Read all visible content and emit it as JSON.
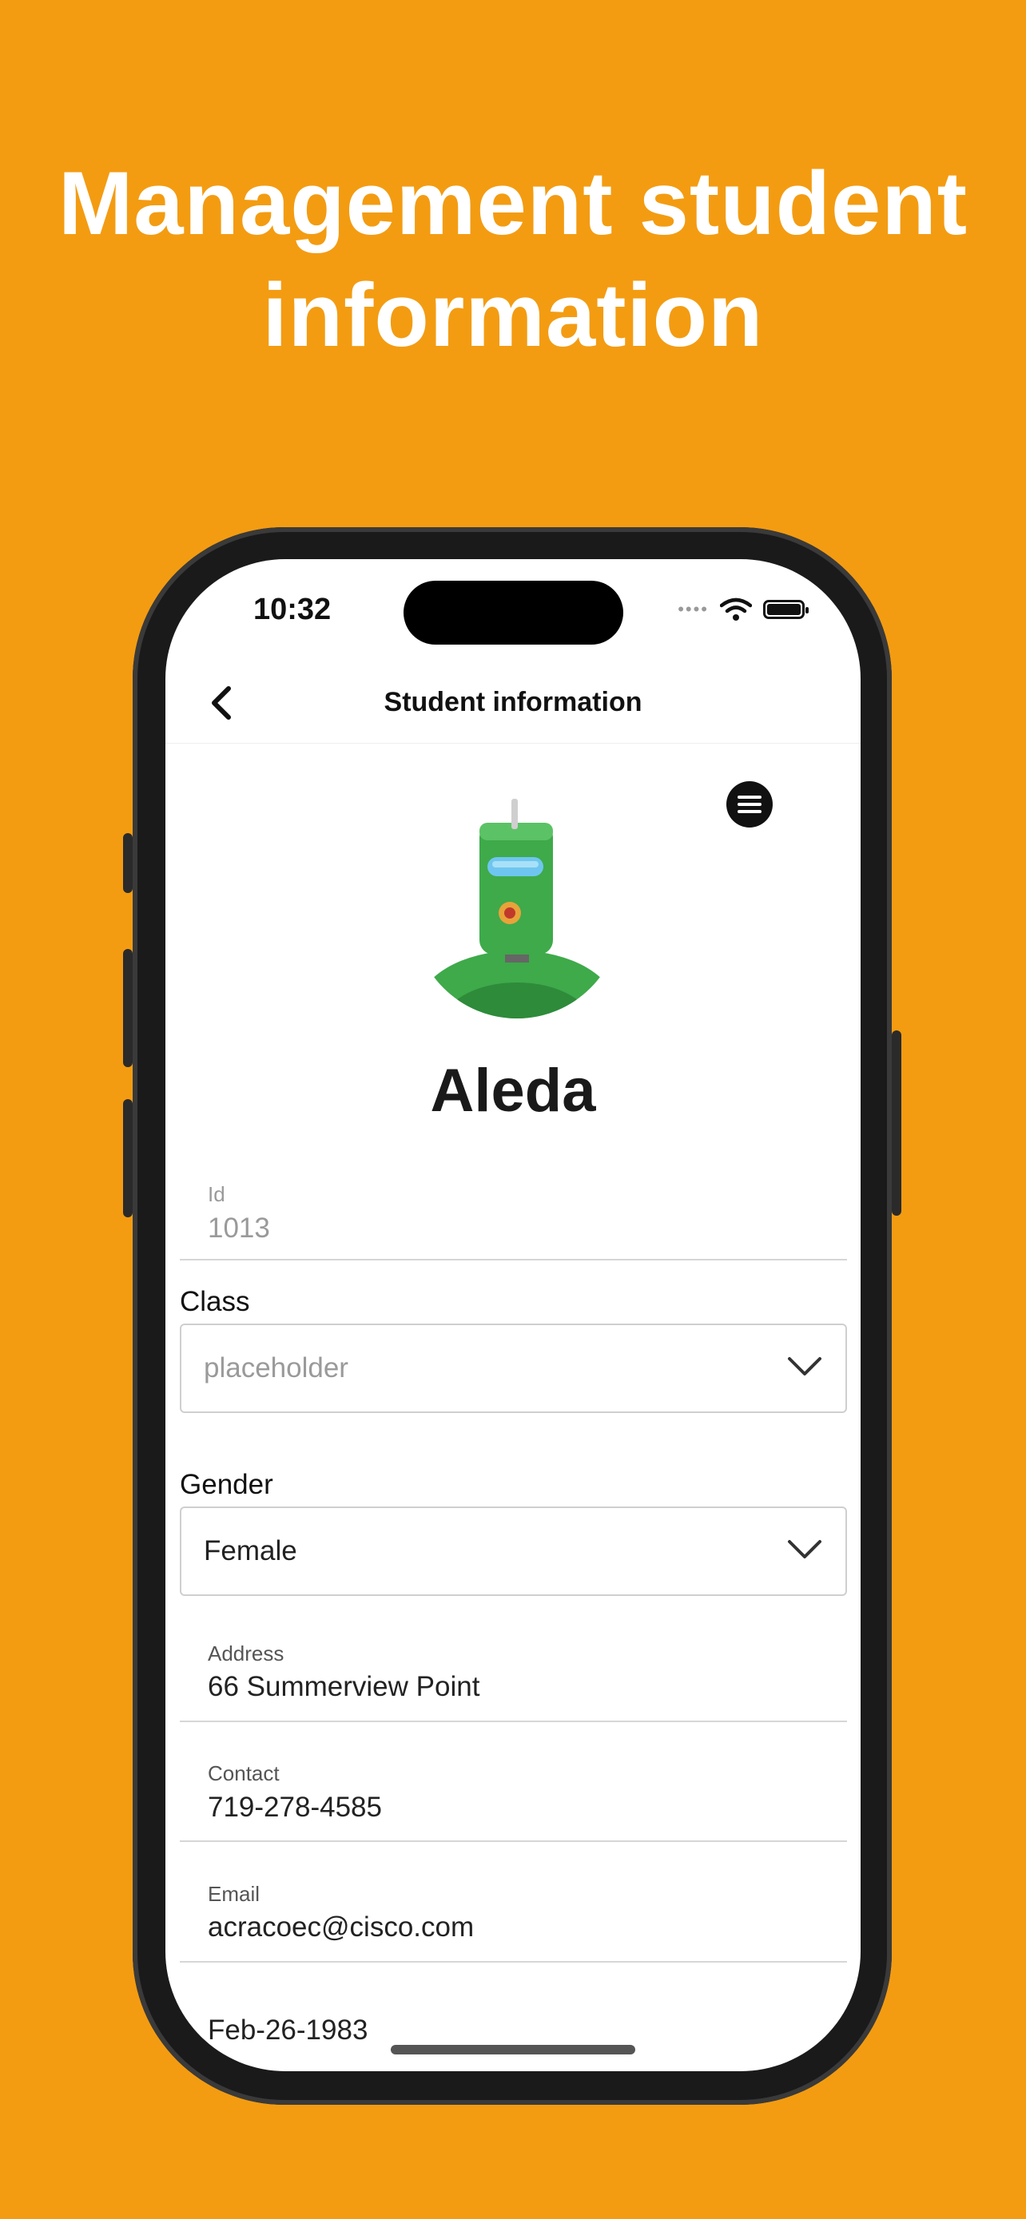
{
  "headline": {
    "line1": "Management student",
    "line2": "information"
  },
  "status_bar": {
    "time": "10:32"
  },
  "nav": {
    "title": "Student information"
  },
  "student": {
    "name": "Aleda"
  },
  "form": {
    "id": {
      "label": "Id",
      "value": "1013"
    },
    "class": {
      "label": "Class",
      "placeholder": "placeholder"
    },
    "gender": {
      "label": "Gender",
      "value": "Female"
    },
    "address": {
      "label": "Address",
      "value": "66 Summerview Point"
    },
    "contact": {
      "label": "Contact",
      "value": "719-278-4585"
    },
    "email": {
      "label": "Email",
      "value": "acracoec@cisco.com"
    },
    "birthdate": {
      "value": "Feb-26-1983"
    }
  },
  "icons": {
    "back": "chevron-left-icon",
    "menu": "menu-icon",
    "dropdown": "chevron-down-icon",
    "wifi": "wifi-icon",
    "battery": "battery-icon"
  },
  "colors": {
    "background": "#F39C12",
    "avatar_green": "#3EAA4A"
  }
}
